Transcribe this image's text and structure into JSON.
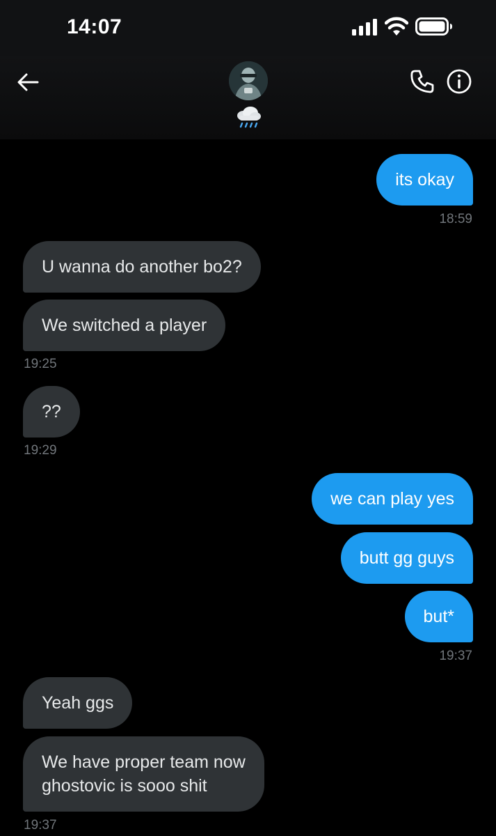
{
  "status_bar": {
    "time": "14:07"
  },
  "header": {
    "avatar_alt": "contact avatar",
    "status_emoji": "rain-cloud-icon"
  },
  "messages": [
    {
      "from": "me",
      "text": "its okay"
    },
    {
      "from": "me_time",
      "text": "18:59"
    },
    {
      "from": "them",
      "text": "U wanna do another bo2?"
    },
    {
      "from": "them",
      "text": "We switched a player"
    },
    {
      "from": "them_time",
      "text": "19:25"
    },
    {
      "from": "them",
      "text": "??"
    },
    {
      "from": "them_time",
      "text": "19:29"
    },
    {
      "from": "me",
      "text": "we can play yes"
    },
    {
      "from": "me",
      "text": "butt gg guys"
    },
    {
      "from": "me",
      "text": "but*"
    },
    {
      "from": "me_time",
      "text": "19:37"
    },
    {
      "from": "them",
      "text": "Yeah ggs"
    },
    {
      "from": "them",
      "text_line1": "We have proper team now",
      "text_line2": "ghostovic is sooo shit"
    },
    {
      "from": "them_time",
      "text": "19:37"
    }
  ],
  "colors": {
    "outgoing_bubble": "#1d9bf0",
    "incoming_bubble": "#2f3336",
    "timestamp": "#71767b",
    "background": "#000000"
  }
}
